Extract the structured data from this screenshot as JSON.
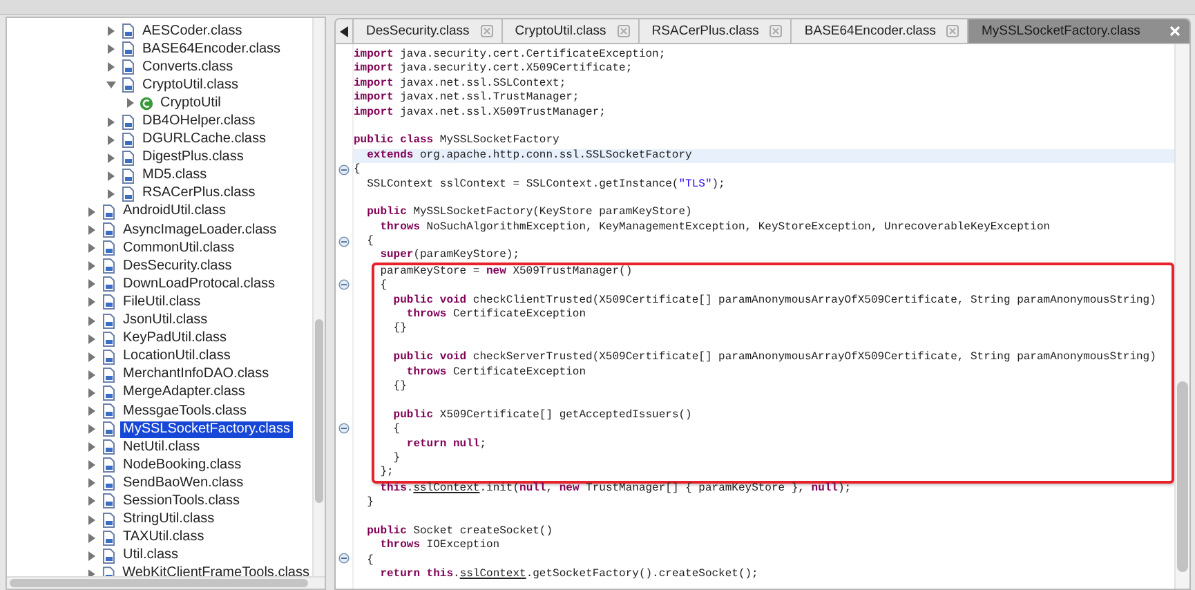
{
  "tree": {
    "scrolled_group": [
      {
        "label": "AESCoder.class",
        "kind": "class_file",
        "expanded": false,
        "selected": false
      },
      {
        "label": "BASE64Encoder.class",
        "kind": "class_file",
        "expanded": false,
        "selected": false
      },
      {
        "label": "Converts.class",
        "kind": "class_file",
        "expanded": false,
        "selected": false
      },
      {
        "label": "CryptoUtil.class",
        "kind": "class_file",
        "expanded": true,
        "selected": false,
        "children": [
          {
            "label": "CryptoUtil",
            "kind": "class",
            "expanded": false,
            "selected": false
          }
        ]
      },
      {
        "label": "DB4OHelper.class",
        "kind": "class_file",
        "expanded": false,
        "selected": false
      },
      {
        "label": "DGURLCache.class",
        "kind": "class_file",
        "expanded": false,
        "selected": false
      },
      {
        "label": "DigestPlus.class",
        "kind": "class_file",
        "expanded": false,
        "selected": false
      },
      {
        "label": "MD5.class",
        "kind": "class_file",
        "expanded": false,
        "selected": false
      },
      {
        "label": "RSACerPlus.class",
        "kind": "class_file",
        "expanded": false,
        "selected": false
      }
    ],
    "items": [
      {
        "label": "AndroidUtil.class",
        "kind": "class_file",
        "expanded": false,
        "selected": false
      },
      {
        "label": "AsyncImageLoader.class",
        "kind": "class_file",
        "expanded": false,
        "selected": false
      },
      {
        "label": "CommonUtil.class",
        "kind": "class_file",
        "expanded": false,
        "selected": false
      },
      {
        "label": "DesSecurity.class",
        "kind": "class_file",
        "expanded": false,
        "selected": false
      },
      {
        "label": "DownLoadProtocal.class",
        "kind": "class_file",
        "expanded": false,
        "selected": false
      },
      {
        "label": "FileUtil.class",
        "kind": "class_file",
        "expanded": false,
        "selected": false
      },
      {
        "label": "JsonUtil.class",
        "kind": "class_file",
        "expanded": false,
        "selected": false
      },
      {
        "label": "KeyPadUtil.class",
        "kind": "class_file",
        "expanded": false,
        "selected": false
      },
      {
        "label": "LocationUtil.class",
        "kind": "class_file",
        "expanded": false,
        "selected": false
      },
      {
        "label": "MerchantInfoDAO.class",
        "kind": "class_file",
        "expanded": false,
        "selected": false
      },
      {
        "label": "MergeAdapter.class",
        "kind": "class_file",
        "expanded": false,
        "selected": false
      },
      {
        "label": "MessgaeTools.class",
        "kind": "class_file",
        "expanded": false,
        "selected": false
      },
      {
        "label": "MySSLSocketFactory.class",
        "kind": "class_file",
        "expanded": false,
        "selected": true
      },
      {
        "label": "NetUtil.class",
        "kind": "class_file",
        "expanded": false,
        "selected": false
      },
      {
        "label": "NodeBooking.class",
        "kind": "class_file",
        "expanded": false,
        "selected": false
      },
      {
        "label": "SendBaoWen.class",
        "kind": "class_file",
        "expanded": false,
        "selected": false
      },
      {
        "label": "SessionTools.class",
        "kind": "class_file",
        "expanded": false,
        "selected": false
      },
      {
        "label": "StringUtil.class",
        "kind": "class_file",
        "expanded": false,
        "selected": false
      },
      {
        "label": "TAXUtil.class",
        "kind": "class_file",
        "expanded": false,
        "selected": false
      },
      {
        "label": "Util.class",
        "kind": "class_file",
        "expanded": false,
        "selected": false
      },
      {
        "label": "WebKitClientFrameTools.class",
        "kind": "class_file",
        "expanded": false,
        "selected": false
      }
    ]
  },
  "editor_tabs": [
    {
      "label": "DesSecurity.class",
      "selected": false
    },
    {
      "label": "CryptoUtil.class",
      "selected": false
    },
    {
      "label": "RSACerPlus.class",
      "selected": false
    },
    {
      "label": "BASE64Encoder.class",
      "selected": false
    },
    {
      "label": "MySSLSocketFactory.class",
      "selected": true
    }
  ],
  "code_lines": [
    {
      "kind": "code",
      "tokens": [
        {
          "kind": "kw",
          "text": "import"
        },
        {
          "kind": "plain",
          "text": " java.security.cert.CertificateException;"
        }
      ]
    },
    {
      "kind": "code",
      "tokens": [
        {
          "kind": "kw",
          "text": "import"
        },
        {
          "kind": "plain",
          "text": " java.security.cert.X509Certificate;"
        }
      ]
    },
    {
      "kind": "code",
      "tokens": [
        {
          "kind": "kw",
          "text": "import"
        },
        {
          "kind": "plain",
          "text": " javax.net.ssl.SSLContext;"
        }
      ]
    },
    {
      "kind": "code",
      "tokens": [
        {
          "kind": "kw",
          "text": "import"
        },
        {
          "kind": "plain",
          "text": " javax.net.ssl.TrustManager;"
        }
      ]
    },
    {
      "kind": "code",
      "tokens": [
        {
          "kind": "kw",
          "text": "import"
        },
        {
          "kind": "plain",
          "text": " javax.net.ssl.X509TrustManager;"
        }
      ]
    },
    {
      "kind": "blank"
    },
    {
      "kind": "code",
      "tokens": [
        {
          "kind": "kw",
          "text": "public class"
        },
        {
          "kind": "plain",
          "text": " MySSLSocketFactory"
        }
      ],
      "children": [
        {
          "kind": "code",
          "selected": true,
          "tokens": [
            {
              "kind": "kw",
              "text": "extends"
            },
            {
              "kind": "plain",
              "text": " org.apache.http.conn.ssl.SSLSocketFactory"
            }
          ]
        }
      ]
    },
    {
      "kind": "code",
      "folded": false,
      "tokens": [
        {
          "kind": "plain",
          "text": "{"
        }
      ],
      "children": [
        {
          "kind": "code",
          "tokens": [
            {
              "kind": "plain",
              "text": "SSLContext sslContext = SSLContext.getInstance("
            },
            {
              "kind": "str",
              "text": "\"TLS\""
            },
            {
              "kind": "plain",
              "text": ");"
            }
          ]
        },
        {
          "kind": "blank"
        },
        {
          "kind": "code",
          "tokens": [
            {
              "kind": "kw",
              "text": "public"
            },
            {
              "kind": "plain",
              "text": " MySSLSocketFactory(KeyStore paramKeyStore)"
            }
          ],
          "children": [
            {
              "kind": "code",
              "tokens": [
                {
                  "kind": "kw",
                  "text": "throws"
                },
                {
                  "kind": "plain",
                  "text": " NoSuchAlgorithmException, KeyManagementException, KeyStoreException, UnrecoverableKeyException"
                }
              ]
            }
          ]
        },
        {
          "kind": "code",
          "folded": false,
          "tokens": [
            {
              "kind": "plain",
              "text": "{"
            }
          ],
          "children": [
            {
              "kind": "code",
              "tokens": [
                {
                  "kind": "kw",
                  "text": "super"
                },
                {
                  "kind": "plain",
                  "text": "(paramKeyStore);"
                }
              ]
            },
            {
              "kind": "code",
              "boxed": true,
              "tokens": [
                {
                  "kind": "plain",
                  "text": "paramKeyStore = "
                },
                {
                  "kind": "kw",
                  "text": "new"
                },
                {
                  "kind": "plain",
                  "text": " X509TrustManager()"
                }
              ]
            },
            {
              "kind": "code",
              "boxed": true,
              "folded": false,
              "tokens": [
                {
                  "kind": "plain",
                  "text": "{"
                }
              ],
              "children": [
                {
                  "kind": "code",
                  "boxed": true,
                  "tokens": [
                    {
                      "kind": "kw",
                      "text": "public void"
                    },
                    {
                      "kind": "plain",
                      "text": " checkClientTrusted(X509Certificate[] paramAnonymousArrayOfX509Certificate, String paramAnonymousString)"
                    }
                  ],
                  "children": [
                    {
                      "kind": "code",
                      "boxed": true,
                      "tokens": [
                        {
                          "kind": "kw",
                          "text": "throws"
                        },
                        {
                          "kind": "plain",
                          "text": " CertificateException"
                        }
                      ]
                    }
                  ]
                },
                {
                  "kind": "code",
                  "boxed": true,
                  "tokens": [
                    {
                      "kind": "plain",
                      "text": "{}"
                    }
                  ]
                },
                {
                  "kind": "blank",
                  "boxed": true
                },
                {
                  "kind": "code",
                  "boxed": true,
                  "tokens": [
                    {
                      "kind": "kw",
                      "text": "public void"
                    },
                    {
                      "kind": "plain",
                      "text": " checkServerTrusted(X509Certificate[] paramAnonymousArrayOfX509Certificate, String paramAnonymousString)"
                    }
                  ],
                  "children": [
                    {
                      "kind": "code",
                      "boxed": true,
                      "tokens": [
                        {
                          "kind": "kw",
                          "text": "throws"
                        },
                        {
                          "kind": "plain",
                          "text": " CertificateException"
                        }
                      ]
                    }
                  ]
                },
                {
                  "kind": "code",
                  "boxed": true,
                  "tokens": [
                    {
                      "kind": "plain",
                      "text": "{}"
                    }
                  ]
                },
                {
                  "kind": "blank",
                  "boxed": true
                },
                {
                  "kind": "code",
                  "boxed": true,
                  "tokens": [
                    {
                      "kind": "kw",
                      "text": "public"
                    },
                    {
                      "kind": "plain",
                      "text": " X509Certificate[] getAcceptedIssuers()"
                    }
                  ]
                },
                {
                  "kind": "code",
                  "boxed": true,
                  "folded": false,
                  "tokens": [
                    {
                      "kind": "plain",
                      "text": "{"
                    }
                  ],
                  "children": [
                    {
                      "kind": "code",
                      "boxed": true,
                      "tokens": [
                        {
                          "kind": "kw",
                          "text": "return null"
                        },
                        {
                          "kind": "plain",
                          "text": ";"
                        }
                      ]
                    }
                  ]
                },
                {
                  "kind": "code",
                  "boxed": true,
                  "tokens": [
                    {
                      "kind": "plain",
                      "text": "}"
                    }
                  ]
                }
              ]
            },
            {
              "kind": "code",
              "boxed": true,
              "tokens": [
                {
                  "kind": "plain",
                  "text": "};"
                }
              ]
            },
            {
              "kind": "code",
              "tokens": [
                {
                  "kind": "kw",
                  "text": "this"
                },
                {
                  "kind": "plain",
                  "text": "."
                },
                {
                  "kind": "field",
                  "text": "sslContext"
                },
                {
                  "kind": "plain",
                  "text": ".init("
                },
                {
                  "kind": "kw",
                  "text": "null"
                },
                {
                  "kind": "plain",
                  "text": ", "
                },
                {
                  "kind": "kw",
                  "text": "new"
                },
                {
                  "kind": "plain",
                  "text": " TrustManager[] { paramKeyStore }, "
                },
                {
                  "kind": "kw",
                  "text": "null"
                },
                {
                  "kind": "plain",
                  "text": ");"
                }
              ]
            }
          ]
        },
        {
          "kind": "code",
          "tokens": [
            {
              "kind": "plain",
              "text": "}"
            }
          ]
        },
        {
          "kind": "blank"
        },
        {
          "kind": "code",
          "tokens": [
            {
              "kind": "kw",
              "text": "public"
            },
            {
              "kind": "plain",
              "text": " Socket createSocket()"
            }
          ],
          "children": [
            {
              "kind": "code",
              "tokens": [
                {
                  "kind": "kw",
                  "text": "throws"
                },
                {
                  "kind": "plain",
                  "text": " IOException"
                }
              ]
            }
          ]
        },
        {
          "kind": "code",
          "folded": false,
          "tokens": [
            {
              "kind": "plain",
              "text": "{"
            }
          ],
          "children": [
            {
              "kind": "code",
              "tokens": [
                {
                  "kind": "kw",
                  "text": "return this"
                },
                {
                  "kind": "plain",
                  "text": "."
                },
                {
                  "kind": "field",
                  "text": "sslContext"
                },
                {
                  "kind": "plain",
                  "text": ".getSocketFactory().createSocket();"
                }
              ]
            }
          ]
        }
      ]
    }
  ]
}
